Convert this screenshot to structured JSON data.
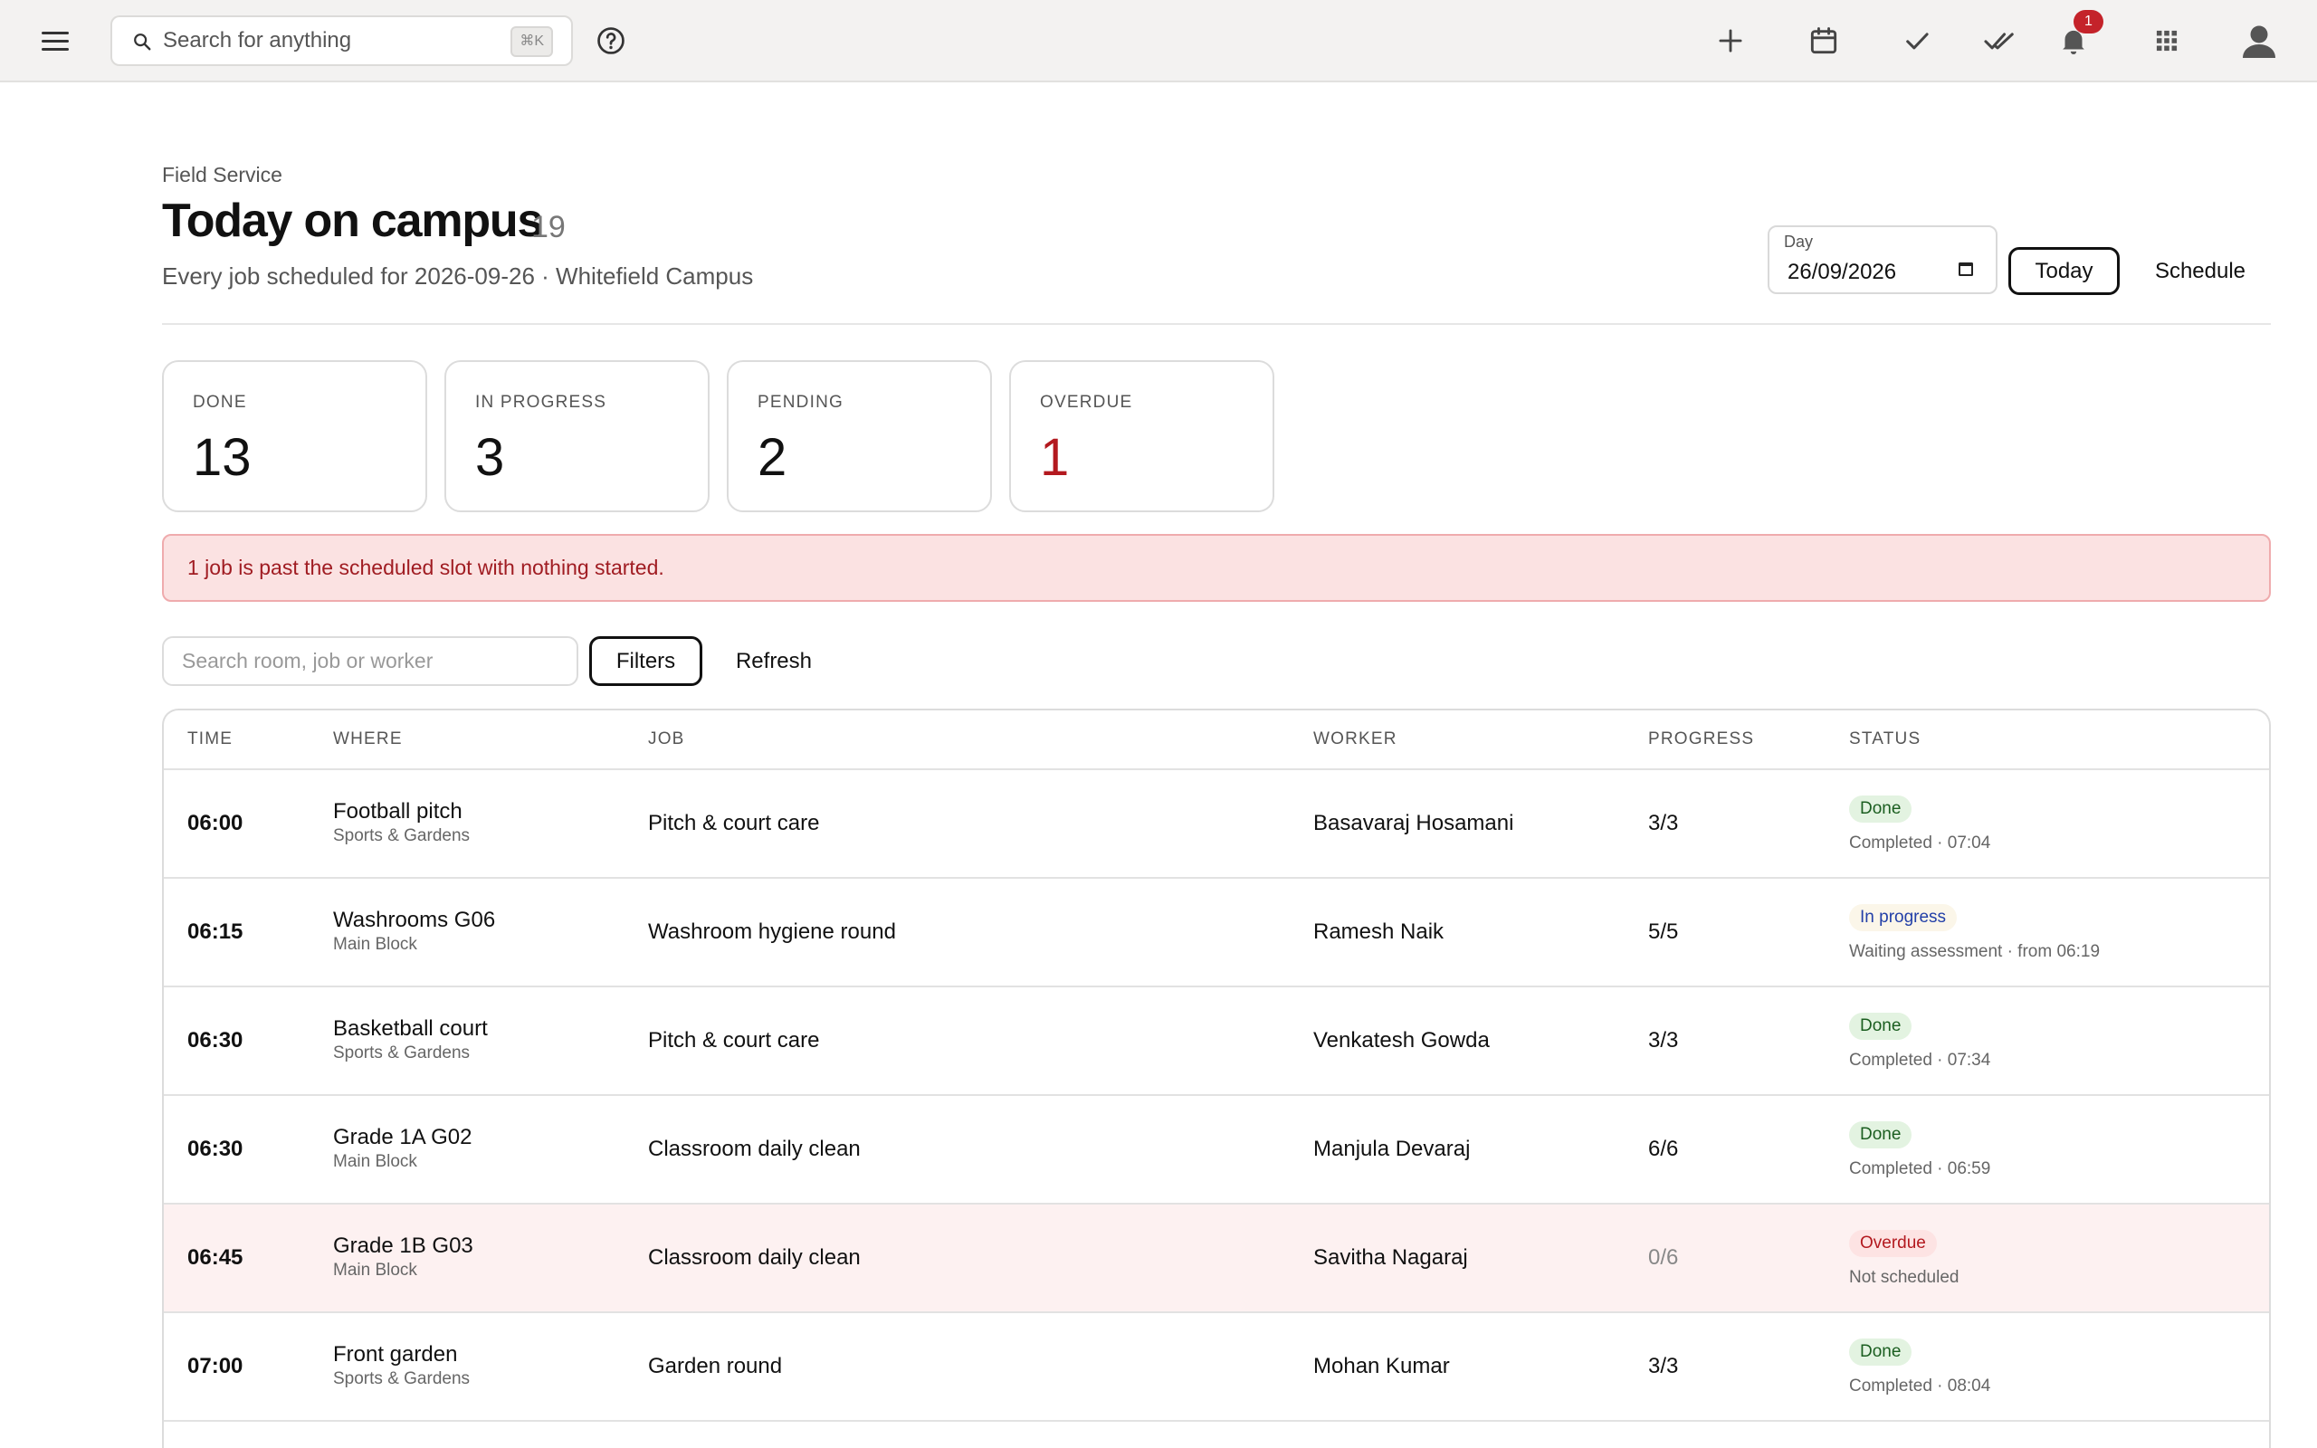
{
  "topbar": {
    "search_placeholder": "Search for anything",
    "shortcut": "⌘K",
    "notification_count": "1"
  },
  "header": {
    "eyebrow": "Field Service",
    "title": "Today on campus",
    "count": "19",
    "subtitle": "Every job scheduled for 2026-09-26 · Whitefield Campus",
    "day_label": "Day",
    "day_value": "26/09/2026",
    "today_label": "Today",
    "schedule_label": "Schedule"
  },
  "stats": [
    {
      "label": "DONE",
      "value": "13"
    },
    {
      "label": "IN PROGRESS",
      "value": "3"
    },
    {
      "label": "PENDING",
      "value": "2"
    },
    {
      "label": "OVERDUE",
      "value": "1"
    }
  ],
  "alert": {
    "text": "1 job is past the scheduled slot with nothing started."
  },
  "filters": {
    "search_placeholder": "Search room, job or worker",
    "filters_label": "Filters",
    "refresh_label": "Refresh"
  },
  "table": {
    "columns": [
      "TIME",
      "WHERE",
      "JOB",
      "WORKER",
      "PROGRESS",
      "STATUS"
    ],
    "rows": [
      {
        "time": "06:00",
        "where": "Football pitch",
        "where_sub": "Sports & Gardens",
        "job": "Pitch & court care",
        "worker": "Basavaraj Hosamani",
        "progress": "3/3",
        "status": "Done",
        "status_sub": "Completed · 07:04"
      },
      {
        "time": "06:15",
        "where": "Washrooms G06",
        "where_sub": "Main Block",
        "job": "Washroom hygiene round",
        "worker": "Ramesh Naik",
        "progress": "5/5",
        "status": "In progress",
        "status_sub": "Waiting assessment · from 06:19"
      },
      {
        "time": "06:30",
        "where": "Basketball court",
        "where_sub": "Sports & Gardens",
        "job": "Pitch & court care",
        "worker": "Venkatesh Gowda",
        "progress": "3/3",
        "status": "Done",
        "status_sub": "Completed · 07:34"
      },
      {
        "time": "06:30",
        "where": "Grade 1A G02",
        "where_sub": "Main Block",
        "job": "Classroom daily clean",
        "worker": "Manjula Devaraj",
        "progress": "6/6",
        "status": "Done",
        "status_sub": "Completed · 06:59"
      },
      {
        "time": "06:45",
        "where": "Grade 1B G03",
        "where_sub": "Main Block",
        "job": "Classroom daily clean",
        "worker": "Savitha Nagaraj",
        "progress": "0/6",
        "status": "Overdue",
        "status_sub": "Not scheduled"
      },
      {
        "time": "07:00",
        "where": "Front garden",
        "where_sub": "Sports & Gardens",
        "job": "Garden round",
        "worker": "Mohan Kumar",
        "progress": "3/3",
        "status": "Done",
        "status_sub": "Completed · 08:04"
      }
    ]
  },
  "colors": {
    "topbar_bg": "#f3f2f1",
    "alert_bg": "#fbe2e2",
    "alert_text": "#a01c22",
    "overdue_red": "#b3191f",
    "done_green_bg": "#e3f3e1",
    "progress_blue_text": "#2340a8"
  },
  "icons": {
    "menu": "hamburger-icon",
    "search": "search-icon",
    "help": "help-circle-icon",
    "add": "plus-icon",
    "calendar": "calendar-icon",
    "check": "check-icon",
    "double_check": "double-check-icon",
    "bell": "bell-icon",
    "apps": "apps-grid-icon",
    "user": "user-avatar-icon"
  }
}
